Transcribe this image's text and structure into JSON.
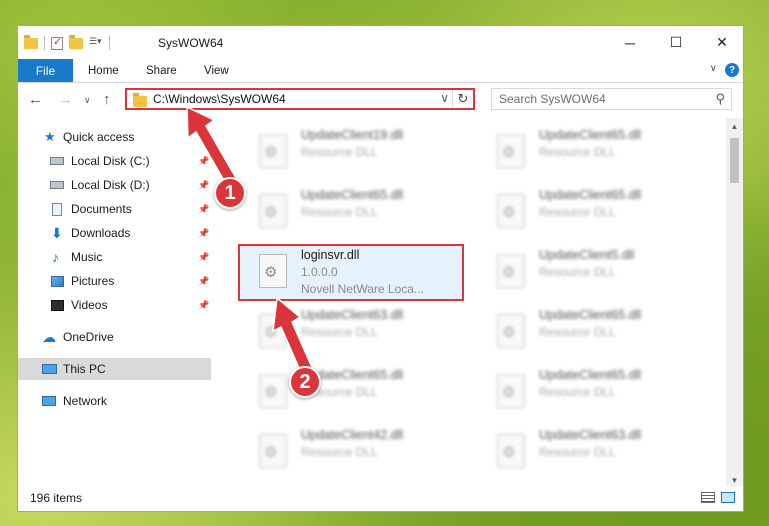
{
  "window": {
    "title": "SysWOW64",
    "controls": {
      "minimize": "─",
      "maximize": "☐",
      "close": "✕"
    }
  },
  "ribbon": {
    "tabs": [
      "File",
      "Home",
      "Share",
      "View"
    ],
    "help": "?"
  },
  "nav": {
    "address": "C:\\Windows\\SysWOW64",
    "search_placeholder": "Search SysWOW64"
  },
  "sidebar": {
    "items": [
      {
        "label": "Quick access"
      },
      {
        "label": "Local Disk (C:)"
      },
      {
        "label": "Local Disk (D:)"
      },
      {
        "label": "Documents"
      },
      {
        "label": "Downloads"
      },
      {
        "label": "Music"
      },
      {
        "label": "Pictures"
      },
      {
        "label": "Videos"
      },
      {
        "label": "OneDrive"
      },
      {
        "label": "This PC"
      },
      {
        "label": "Network"
      }
    ]
  },
  "files": {
    "left": [
      {
        "name": "UpdateClient19.dll",
        "type": "Resource DLL"
      },
      {
        "name": "UpdateClient65.dll",
        "type": "Resource DLL"
      },
      {
        "name": "loginsvr.dll",
        "type": "1.0.0.0",
        "desc": "Novell NetWare Loca..."
      },
      {
        "name": "UpdateClient63.dll",
        "type": "Resource DLL"
      },
      {
        "name": "UpdateClient65.dll",
        "type": "Resource DLL"
      },
      {
        "name": "UpdateClient42.dll",
        "type": "Resource DLL"
      }
    ],
    "right": [
      {
        "name": "UpdateClient65.dll",
        "type": "Resource DLL"
      },
      {
        "name": "UpdateClient65.dll",
        "type": "Resource DLL"
      },
      {
        "name": "UpdateClient5.dll",
        "type": "Resource DLL"
      },
      {
        "name": "UpdateClient65.dll",
        "type": "Resource DLL"
      },
      {
        "name": "UpdateClient65.dll",
        "type": "Resource DLL"
      },
      {
        "name": "UpdateClient63.dll",
        "type": "Resource DLL"
      }
    ]
  },
  "status": {
    "count": "196 items"
  },
  "callouts": [
    "1",
    "2"
  ],
  "colors": {
    "accent": "#1979ca",
    "highlight": "#d9353a"
  }
}
